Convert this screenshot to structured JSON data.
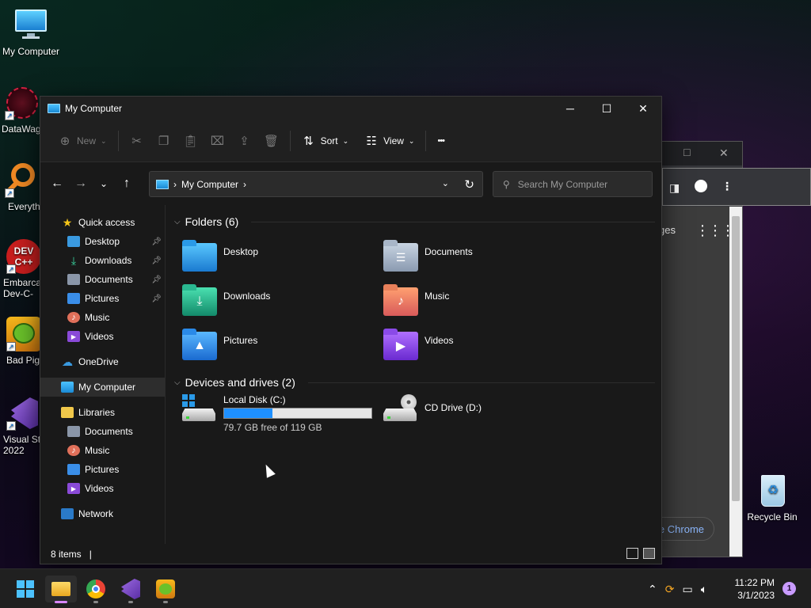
{
  "desktop": {
    "icons": [
      {
        "label": "My Computer"
      },
      {
        "label": "DataWag"
      },
      {
        "label": "Everyth"
      },
      {
        "label": "Embarca\nDev-C-"
      },
      {
        "label": "Bad Pig"
      },
      {
        "label": "Visual St\n2022"
      },
      {
        "label": "Recycle Bin"
      }
    ]
  },
  "chrome": {
    "partial_text_1": "ges",
    "partial_text_2": "e Chrome"
  },
  "window": {
    "title": "My Computer",
    "minimize": "─",
    "maximize": "☐",
    "close": "✕"
  },
  "toolbar": {
    "new_label": "New",
    "sort_label": "Sort",
    "view_label": "View",
    "more_label": "•••"
  },
  "address": {
    "path": "My Computer",
    "separator": "›",
    "search_placeholder": "Search My Computer"
  },
  "sidebar": {
    "items": [
      {
        "label": "Quick access"
      },
      {
        "label": "Desktop"
      },
      {
        "label": "Downloads"
      },
      {
        "label": "Documents"
      },
      {
        "label": "Pictures"
      },
      {
        "label": "Music"
      },
      {
        "label": "Videos"
      },
      {
        "label": "OneDrive"
      },
      {
        "label": "My Computer"
      },
      {
        "label": "Libraries"
      },
      {
        "label": "Documents"
      },
      {
        "label": "Music"
      },
      {
        "label": "Pictures"
      },
      {
        "label": "Videos"
      },
      {
        "label": "Network"
      }
    ]
  },
  "content": {
    "folders_header": "Folders (6)",
    "folders": [
      {
        "label": "Desktop"
      },
      {
        "label": "Documents"
      },
      {
        "label": "Downloads"
      },
      {
        "label": "Music"
      },
      {
        "label": "Pictures"
      },
      {
        "label": "Videos"
      }
    ],
    "drives_header": "Devices and drives (2)",
    "drives": [
      {
        "label": "Local Disk (C:)",
        "free_text": "79.7 GB free of 119 GB",
        "used_fraction": 0.33
      },
      {
        "label": "CD Drive (D:)"
      }
    ]
  },
  "status": {
    "items_text": "8 items",
    "separator": "|"
  },
  "taskbar": {
    "time": "11:22 PM",
    "date": "3/1/2023",
    "notification_count": "1"
  },
  "colors": {
    "accent": "#1e90ff",
    "window_bg": "#191919",
    "taskbar_bg": "#202020"
  }
}
